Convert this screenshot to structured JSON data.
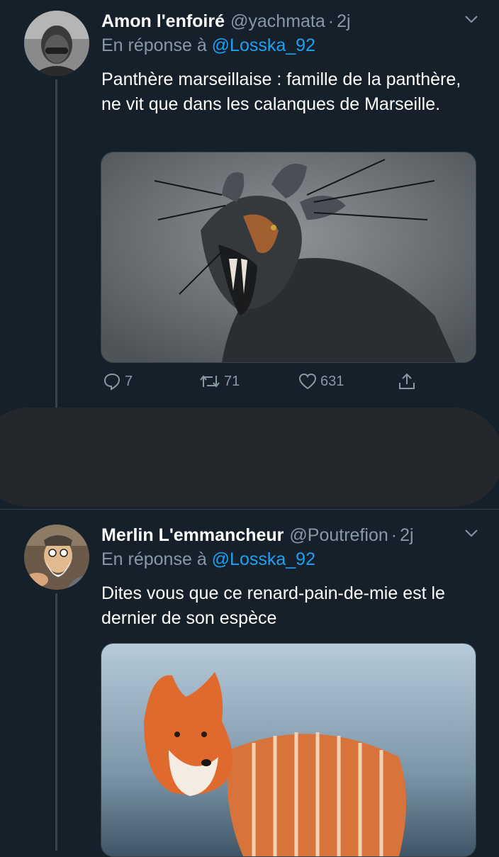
{
  "tweets": [
    {
      "name": "Amon l'enfoiré",
      "handle": "@yachmata",
      "separator": "·",
      "time": "2j",
      "reply_prefix": "En réponse à",
      "reply_to": "@Losska_92",
      "text": "Panthère marseillaise : famille de la panthère, ne vit que dans les calanques de Marseille.",
      "media_icon": "creature-photo",
      "actions": {
        "replies": "7",
        "retweets": "71",
        "likes": "631"
      }
    },
    {
      "name": "Merlin L'emmancheur",
      "handle": "@Poutrefion",
      "separator": "·",
      "time": "2j",
      "reply_prefix": "En réponse à",
      "reply_to": "@Losska_92",
      "text": "Dites vous que ce renard-pain-de-mie est le dernier de son espèce",
      "media_icon": "fox-bread-photo"
    }
  ],
  "icons": {
    "reply": "reply-icon",
    "retweet": "retweet-icon",
    "like": "heart-icon",
    "share": "share-icon",
    "menu": "chevron-down-icon"
  },
  "colors": {
    "background": "#15202b",
    "secondary_text": "#8899a6",
    "link": "#1da1f2",
    "divider": "#38444d",
    "redaction": "#24282d"
  }
}
